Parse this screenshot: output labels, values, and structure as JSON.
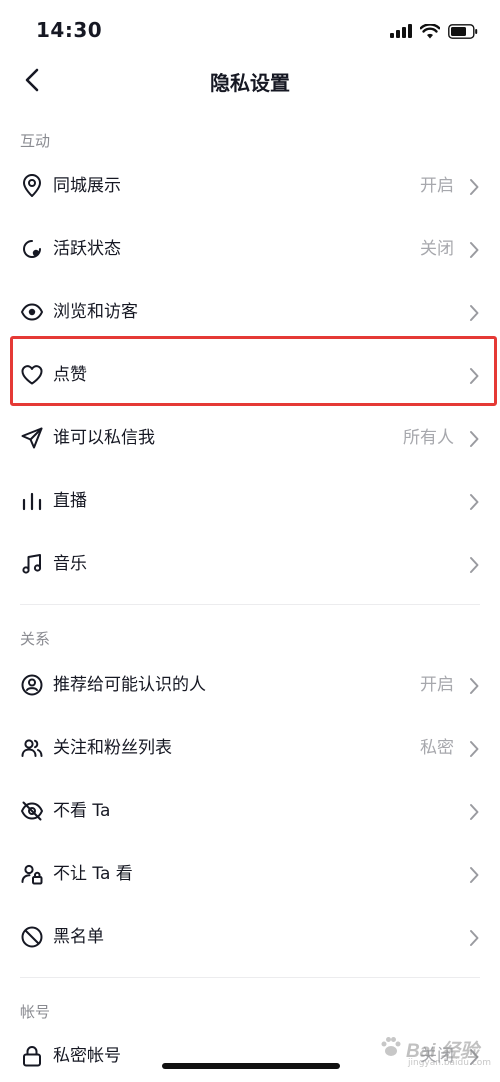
{
  "status_bar": {
    "time": "14:30"
  },
  "nav": {
    "title": "隐私设置"
  },
  "sections": {
    "interaction": {
      "header": "互动"
    },
    "relations": {
      "header": "关系"
    },
    "account": {
      "header": "帐号"
    }
  },
  "rows": {
    "nearby": {
      "label": "同城展示",
      "value": "开启",
      "icon": "location-pin-icon"
    },
    "active_status": {
      "label": "活跃状态",
      "value": "关闭",
      "icon": "active-status-icon"
    },
    "browse_visitors": {
      "label": "浏览和访客",
      "value": "",
      "icon": "eye-icon"
    },
    "likes": {
      "label": "点赞",
      "value": "",
      "icon": "heart-icon"
    },
    "messages": {
      "label": "谁可以私信我",
      "value": "所有人",
      "icon": "send-icon"
    },
    "live": {
      "label": "直播",
      "value": "",
      "icon": "live-bars-icon"
    },
    "music": {
      "label": "音乐",
      "value": "",
      "icon": "music-note-icon"
    },
    "recommend": {
      "label": "推荐给可能认识的人",
      "value": "开启",
      "icon": "user-circle-icon"
    },
    "follow_lists": {
      "label": "关注和粉丝列表",
      "value": "私密",
      "icon": "users-icon"
    },
    "hide_from": {
      "label": "不看 Ta",
      "value": "",
      "icon": "eye-off-icon"
    },
    "block_viewing": {
      "label": "不让 Ta 看",
      "value": "",
      "icon": "user-lock-icon"
    },
    "blacklist": {
      "label": "黑名单",
      "value": "",
      "icon": "ban-icon"
    },
    "private_account": {
      "label": "私密帐号",
      "value": "关闭",
      "icon": "lock-icon"
    }
  },
  "watermark": {
    "text": "Bai 经验",
    "sub": "jingyan.baidu.com"
  },
  "colors": {
    "highlight": "#e53935",
    "text": "#161823",
    "secondary": "#a7a8ad",
    "section": "#8a8b91"
  }
}
